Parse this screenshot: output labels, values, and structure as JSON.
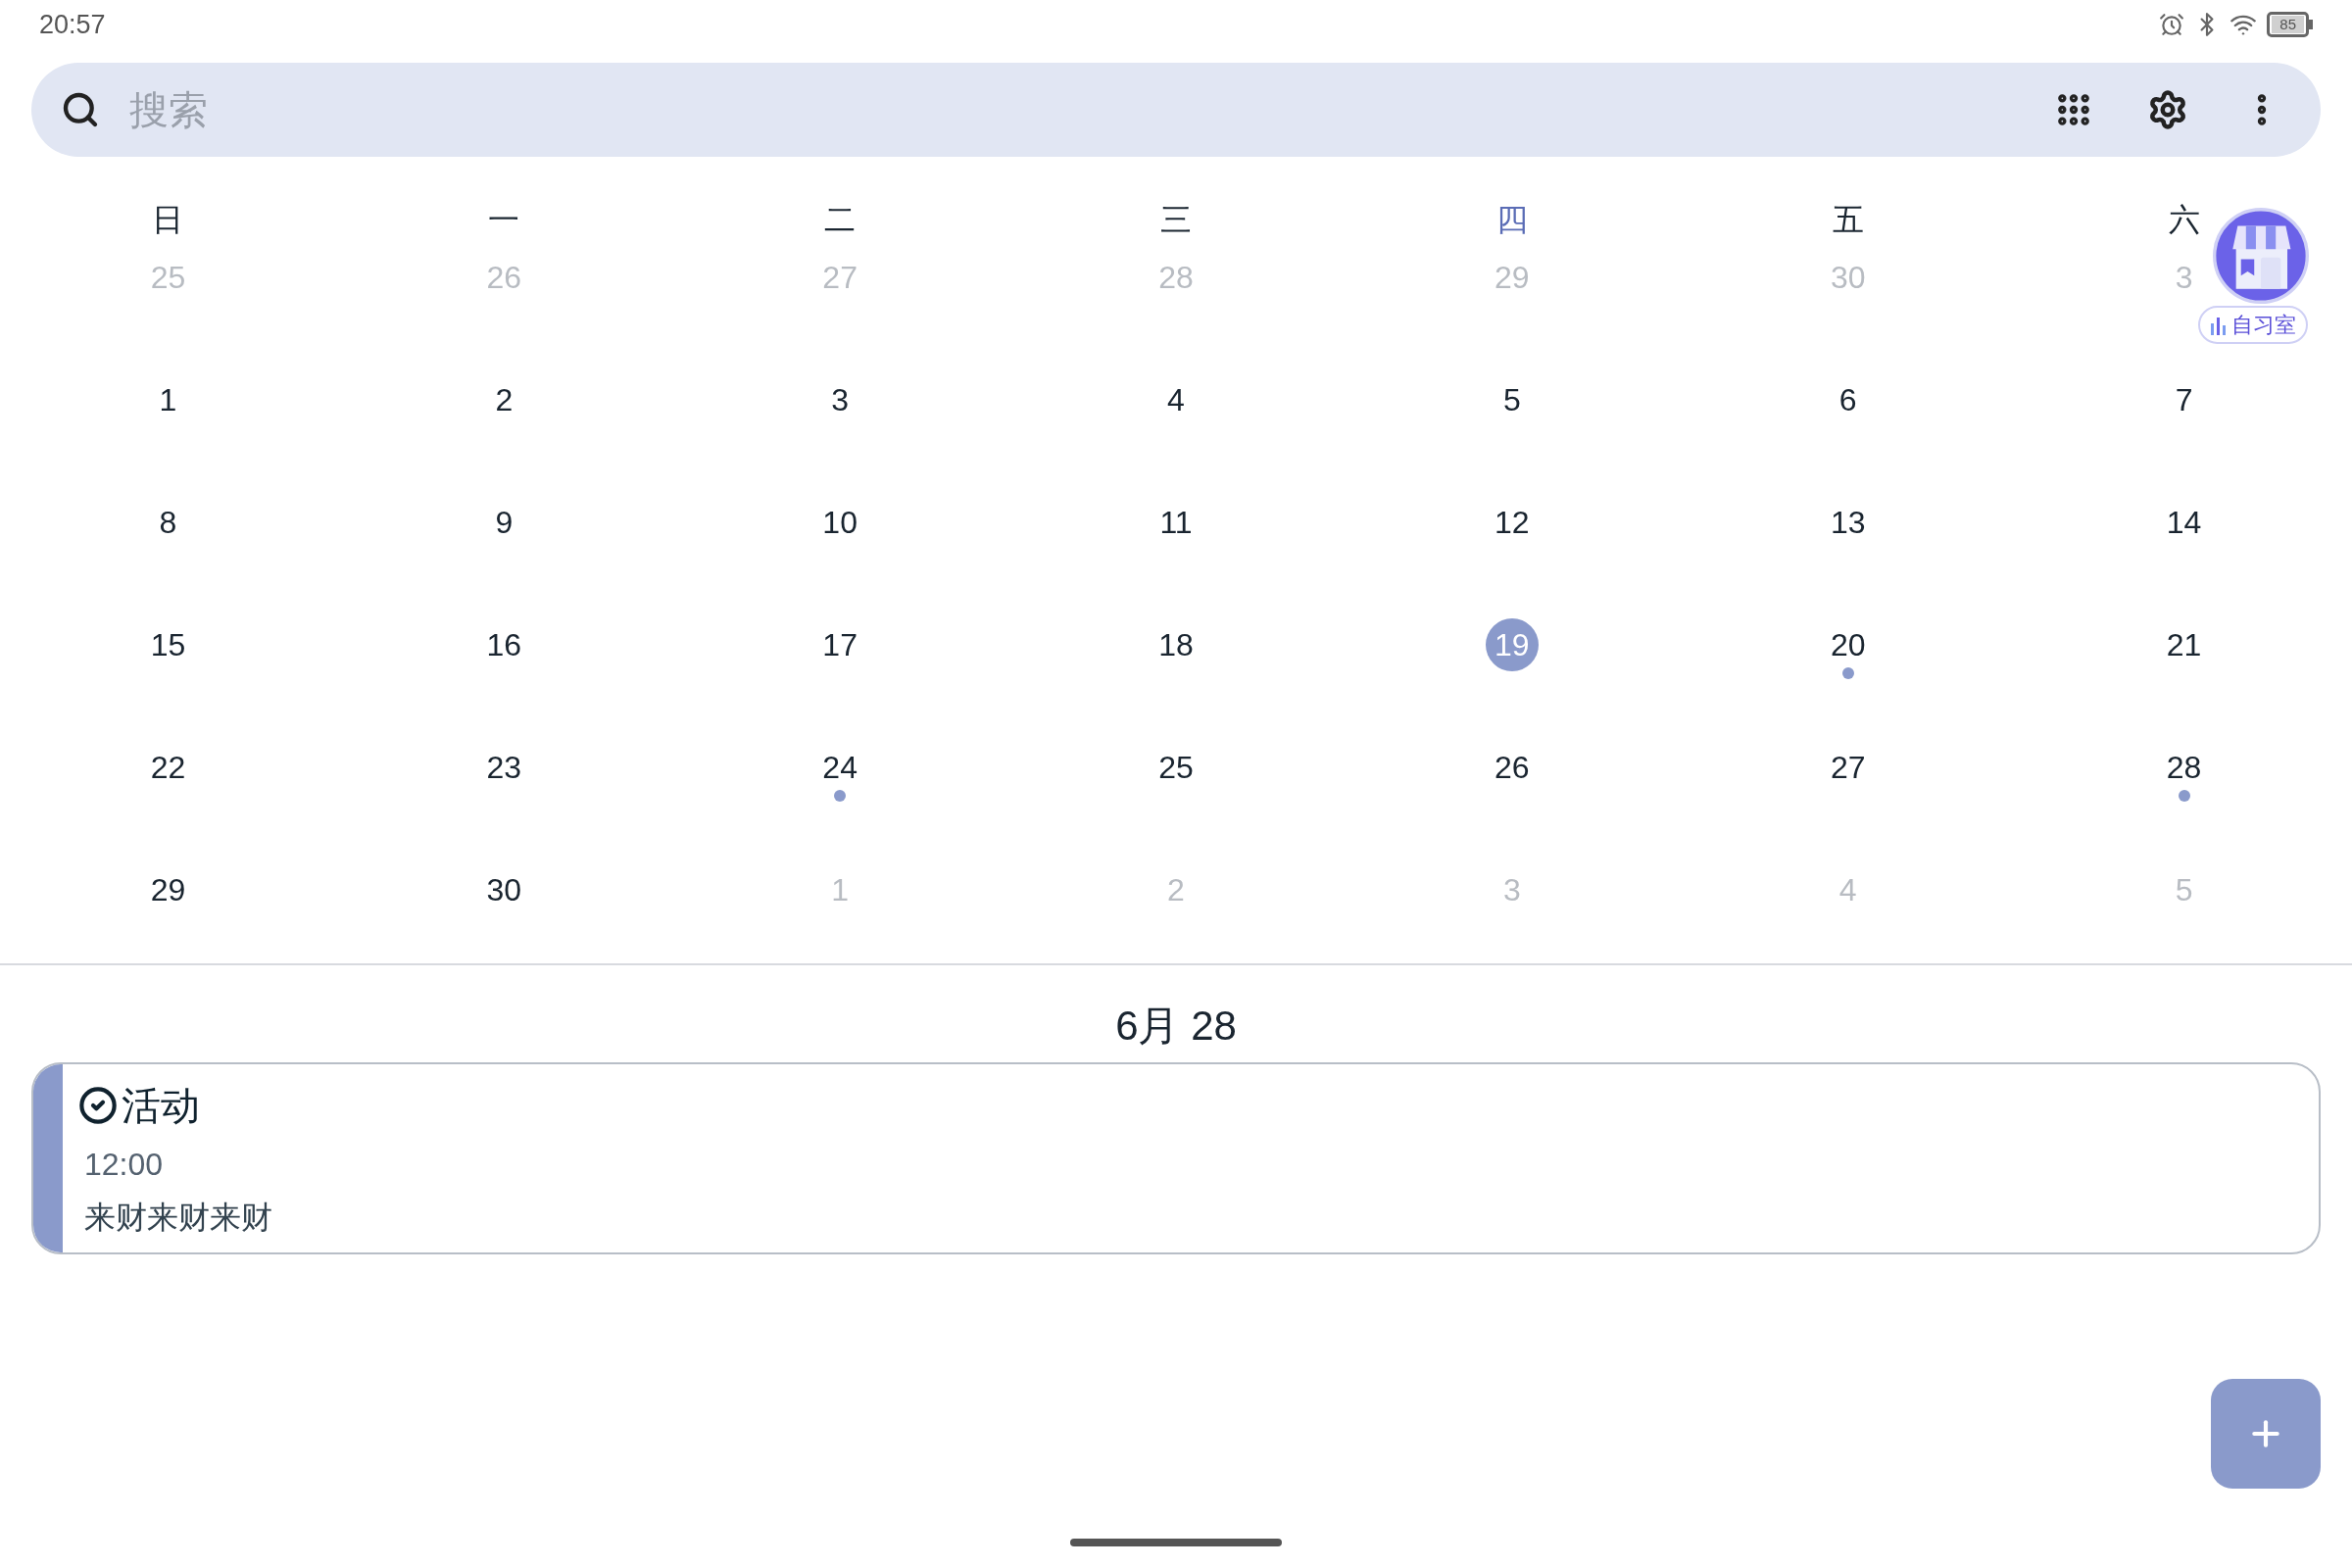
{
  "status_bar": {
    "time": "20:57",
    "battery": "85"
  },
  "search": {
    "placeholder": "搜索"
  },
  "weekdays": [
    {
      "label": "日",
      "selected": false
    },
    {
      "label": "一",
      "selected": false
    },
    {
      "label": "二",
      "selected": false
    },
    {
      "label": "三",
      "selected": false
    },
    {
      "label": "四",
      "selected": true
    },
    {
      "label": "五",
      "selected": false
    },
    {
      "label": "六",
      "selected": false
    }
  ],
  "weeks": [
    [
      {
        "day": "25",
        "muted": true,
        "selected": false,
        "event": false
      },
      {
        "day": "26",
        "muted": true,
        "selected": false,
        "event": false
      },
      {
        "day": "27",
        "muted": true,
        "selected": false,
        "event": false
      },
      {
        "day": "28",
        "muted": true,
        "selected": false,
        "event": false
      },
      {
        "day": "29",
        "muted": true,
        "selected": false,
        "event": false
      },
      {
        "day": "30",
        "muted": true,
        "selected": false,
        "event": false
      },
      {
        "day": "3",
        "muted": true,
        "selected": false,
        "event": false
      }
    ],
    [
      {
        "day": "1",
        "muted": false,
        "selected": false,
        "event": false
      },
      {
        "day": "2",
        "muted": false,
        "selected": false,
        "event": false
      },
      {
        "day": "3",
        "muted": false,
        "selected": false,
        "event": false
      },
      {
        "day": "4",
        "muted": false,
        "selected": false,
        "event": false
      },
      {
        "day": "5",
        "muted": false,
        "selected": false,
        "event": false
      },
      {
        "day": "6",
        "muted": false,
        "selected": false,
        "event": false
      },
      {
        "day": "7",
        "muted": false,
        "selected": false,
        "event": false
      }
    ],
    [
      {
        "day": "8",
        "muted": false,
        "selected": false,
        "event": false
      },
      {
        "day": "9",
        "muted": false,
        "selected": false,
        "event": false
      },
      {
        "day": "10",
        "muted": false,
        "selected": false,
        "event": false
      },
      {
        "day": "11",
        "muted": false,
        "selected": false,
        "event": false
      },
      {
        "day": "12",
        "muted": false,
        "selected": false,
        "event": false
      },
      {
        "day": "13",
        "muted": false,
        "selected": false,
        "event": false
      },
      {
        "day": "14",
        "muted": false,
        "selected": false,
        "event": false
      }
    ],
    [
      {
        "day": "15",
        "muted": false,
        "selected": false,
        "event": false
      },
      {
        "day": "16",
        "muted": false,
        "selected": false,
        "event": false
      },
      {
        "day": "17",
        "muted": false,
        "selected": false,
        "event": false
      },
      {
        "day": "18",
        "muted": false,
        "selected": false,
        "event": false
      },
      {
        "day": "19",
        "muted": false,
        "selected": true,
        "event": false
      },
      {
        "day": "20",
        "muted": false,
        "selected": false,
        "event": true
      },
      {
        "day": "21",
        "muted": false,
        "selected": false,
        "event": false
      }
    ],
    [
      {
        "day": "22",
        "muted": false,
        "selected": false,
        "event": false
      },
      {
        "day": "23",
        "muted": false,
        "selected": false,
        "event": false
      },
      {
        "day": "24",
        "muted": false,
        "selected": false,
        "event": true
      },
      {
        "day": "25",
        "muted": false,
        "selected": false,
        "event": false
      },
      {
        "day": "26",
        "muted": false,
        "selected": false,
        "event": false
      },
      {
        "day": "27",
        "muted": false,
        "selected": false,
        "event": false
      },
      {
        "day": "28",
        "muted": false,
        "selected": false,
        "event": true
      }
    ],
    [
      {
        "day": "29",
        "muted": false,
        "selected": false,
        "event": false
      },
      {
        "day": "30",
        "muted": false,
        "selected": false,
        "event": false
      },
      {
        "day": "1",
        "muted": true,
        "selected": false,
        "event": false
      },
      {
        "day": "2",
        "muted": true,
        "selected": false,
        "event": false
      },
      {
        "day": "3",
        "muted": true,
        "selected": false,
        "event": false
      },
      {
        "day": "4",
        "muted": true,
        "selected": false,
        "event": false
      },
      {
        "day": "5",
        "muted": true,
        "selected": false,
        "event": false
      }
    ]
  ],
  "floating_badge": {
    "label": "自习室"
  },
  "agenda": {
    "date": "6月 28",
    "events": [
      {
        "title": "活动",
        "done": true,
        "time": "12:00",
        "description": "来财来财来财",
        "color": "#8a9acb"
      }
    ]
  }
}
